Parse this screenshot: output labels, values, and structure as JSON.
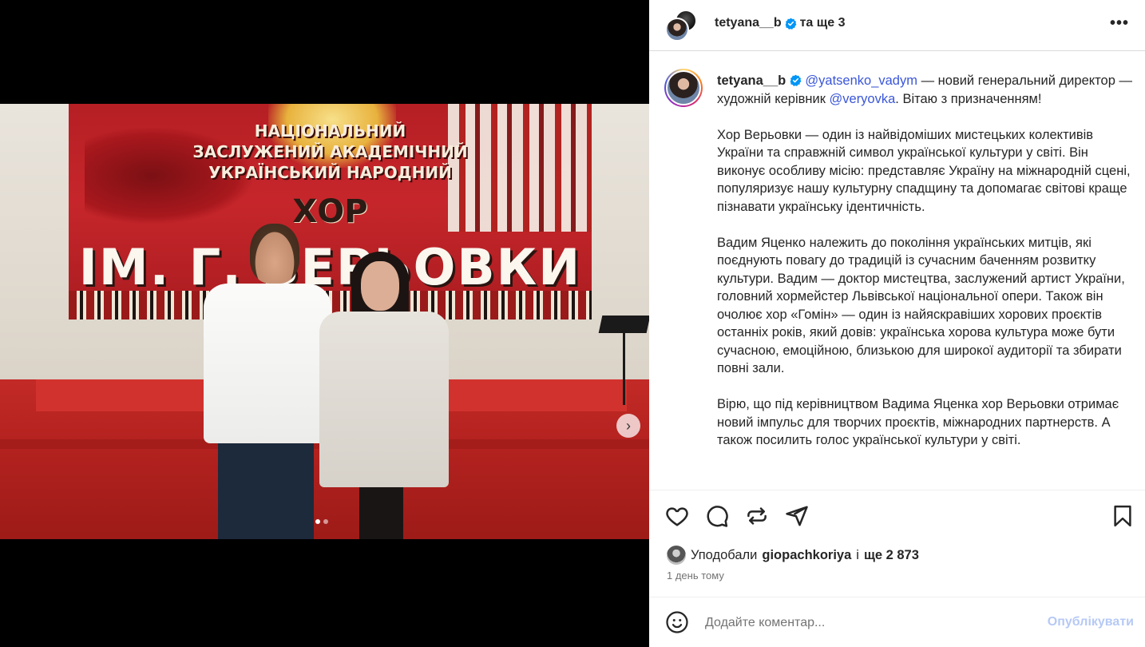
{
  "photo": {
    "banner_line1": "НАЦІОНАЛЬНИЙ",
    "banner_line2": "ЗАСЛУЖЕНИЙ АКАДЕМІЧНИЙ",
    "banner_line3": "УКРАЇНСЬКИЙ НАРОДНИЙ",
    "banner_line4": "ХОР",
    "banner_line5": "ІМ. Г. ВЕРЬОВКИ",
    "carousel_count": 2,
    "carousel_active": 1
  },
  "header": {
    "username": "tetyana__b",
    "collab_suffix": "та ще 3",
    "more_icon": "more-horizontal-icon"
  },
  "caption": {
    "username": "tetyana__b",
    "mention1": "@yatsenko_vadym",
    "p1_text1": " — новий генеральний директор — художній керівник ",
    "mention2": "@veryovka",
    "p1_text2": ". Вітаю з призначенням!",
    "p2": "Хор Верьовки — один із найвідоміших мистецьких колективів України та справжній символ української культури у світі. Він виконує особливу місію: представляє Україну на міжнародній сцені, популяризує нашу культурну спадщину та допомагає світові краще пізнавати українську ідентичність.",
    "p3": "Вадим Яценко належить до покоління українських митців, які поєднують повагу до традицій із сучасним баченням розвитку культури. Вадим — доктор мистецтва, заслужений артист України, головний хормейстер Львівської національної опери. Також він очолює хор «Гомін» — один із найяскравіших хорових проєктів останніх років, який довів: українська хорова культура може бути сучасною, емоційною, близькою для широкої аудиторії та збирати повні зали.",
    "p4": "Вірю, що під керівництвом Вадима Яценка хор Верьовки отримає новий імпульс для творчих проєктів, міжнародних партнерств. А також посилить голос української культури у світі."
  },
  "likes": {
    "prefix": "Уподобали",
    "user": "giopachkoriya",
    "middle": "і",
    "count": "ще 2 873"
  },
  "timestamp": "1 день тому",
  "comment": {
    "placeholder": "Додайте коментар...",
    "post_label": "Опублікувати"
  },
  "colors": {
    "mention": "#3a56d8",
    "verified": "#0095f6",
    "post_disabled": "#b6c9f5"
  }
}
